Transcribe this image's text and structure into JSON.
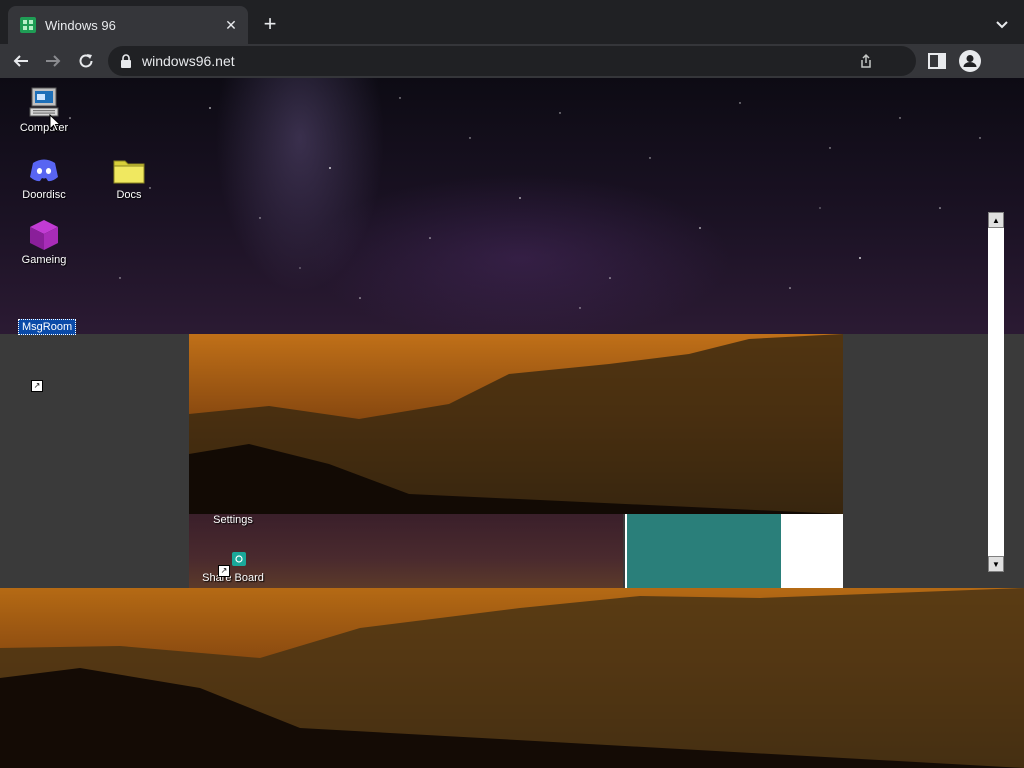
{
  "browser": {
    "tab_title": "Windows 96",
    "tab_close": "✕",
    "new_tab": "+",
    "url": "windows96.net"
  },
  "desktop": {
    "icons": [
      {
        "label": "Computer",
        "icon": "computer-icon"
      },
      {
        "label": "Doordisc",
        "icon": "discord-icon"
      },
      {
        "label": "Docs",
        "icon": "folder-icon"
      },
      {
        "label": "Gameing",
        "icon": "cube-icon"
      },
      {
        "label": "Settings",
        "icon": "settings-icon"
      },
      {
        "label": "Share Board",
        "icon": "share-board-icon"
      }
    ],
    "selected_label": "MsgRoom"
  },
  "colors": {
    "chrome_bg": "#202124",
    "toolbar_bg": "#35363a",
    "selection": "#0a4aa8",
    "teal_panel": "#2a7f7a"
  }
}
